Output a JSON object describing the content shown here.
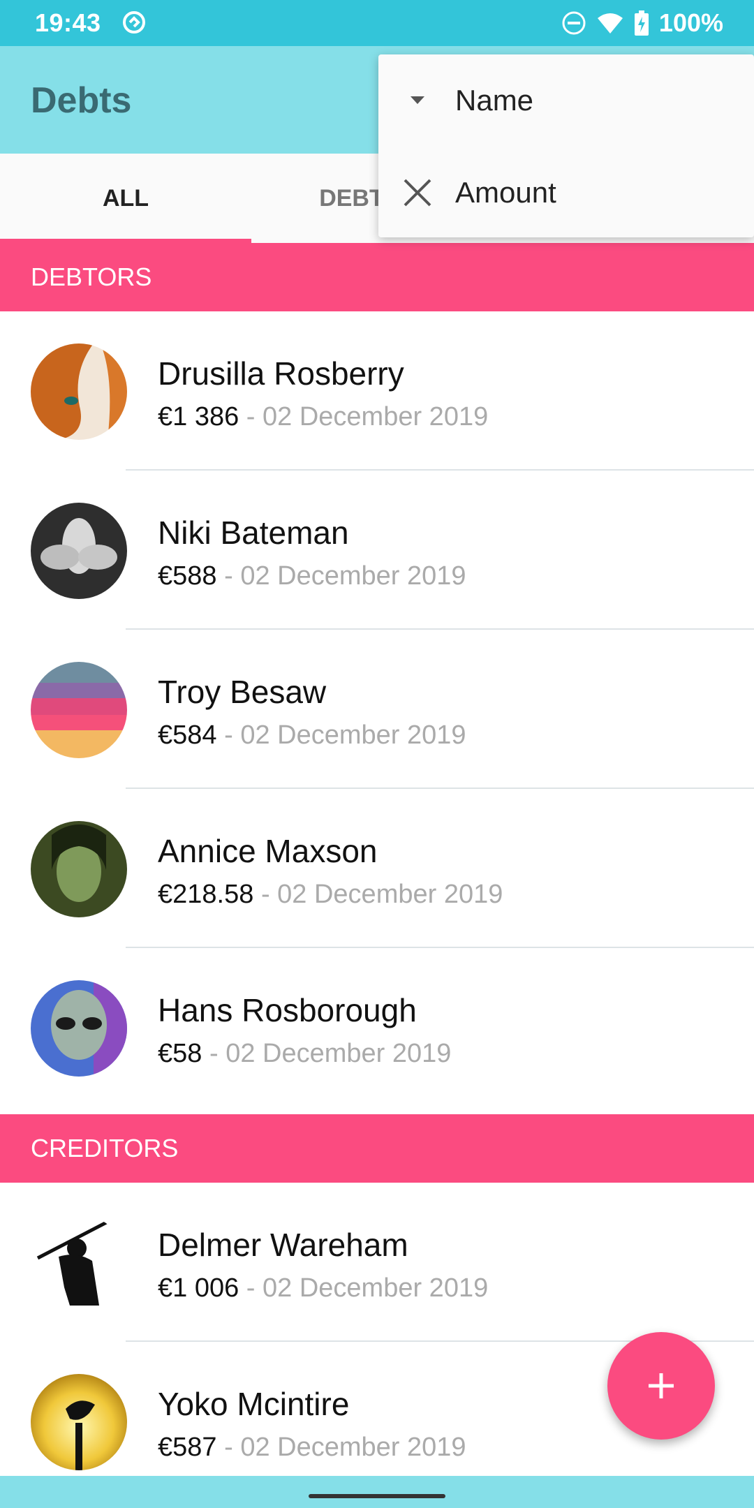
{
  "status_bar": {
    "time": "19:43",
    "battery": "100%"
  },
  "app_bar": {
    "title": "Debts"
  },
  "tabs": [
    {
      "label": "ALL",
      "active": true
    },
    {
      "label": "DEBTORS",
      "active": false
    }
  ],
  "sort_menu": {
    "items": [
      {
        "label": "Name",
        "icon": "caret-down-icon"
      },
      {
        "label": "Amount",
        "icon": "close-icon"
      }
    ]
  },
  "sections": {
    "debtors": {
      "title": "DEBTORS",
      "items": [
        {
          "name": "Drusilla Rosberry",
          "amount": "€1 386",
          "date": "02 December 2019",
          "avatar": "red-haired-woman-avatar"
        },
        {
          "name": "Niki Bateman",
          "amount": "€588",
          "date": "02 December 2019",
          "avatar": "white-flower-avatar"
        },
        {
          "name": "Troy Besaw",
          "amount": "€584",
          "date": "02 December 2019",
          "avatar": "sunset-stripes-avatar"
        },
        {
          "name": "Annice Maxson",
          "amount": "€218.58",
          "date": "02 December 2019",
          "avatar": "green-woman-avatar"
        },
        {
          "name": "Hans Rosborough",
          "amount": "€58",
          "date": "02 December 2019",
          "avatar": "alien-avatar"
        }
      ]
    },
    "creditors": {
      "title": "CREDITORS",
      "items": [
        {
          "name": "Delmer Wareham",
          "amount": "€1 006",
          "date": "02 December 2019",
          "avatar": "samurai-silhouette-avatar"
        },
        {
          "name": "Yoko Mcintire",
          "amount": "€587",
          "date": "02 December 2019",
          "avatar": "bird-silhouette-avatar"
        }
      ]
    }
  },
  "separator": "-",
  "colors": {
    "accent": "#fb4b80",
    "primary": "#85dfe8",
    "primary_dark": "#33c5d9"
  }
}
